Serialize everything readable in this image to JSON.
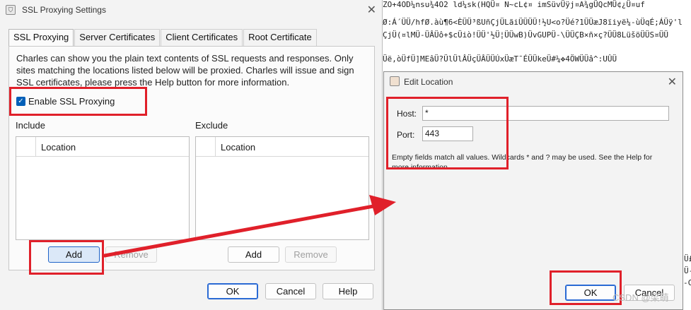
{
  "background_text": {
    "line1": "ZO+4OD¼nsu¾4O2 ld¼sk(HQÜ¤ N~cL¢¤ imSüvÜÿj¤A¾gÜQcMÜ¢¿Ü¤uf",
    "line2": "Ø:Á´ÜÜ/hfØ.àù¶6<ÈÜÜ³ßUñÇjÜLãiÜÜÜÜ!½U<o?Üé?1ÜÜæJ8ïiyë¼-ùÜqÉ;ÁÜÿ'l",
    "line3": "ÇjÜ(¤lMÜ-ÜÂÜô+$cÜiò!ÜÜ'½Ü¦ÜÜwB)ÜvGUPÜ-\\ÜÜÇB×ñ×ç?ÜÜ8LüšöÜÜS¤ÜÜ",
    "line4": "Üë,òÜfÜ]MEâÜ?ÜlÜlÂÜçÜÂÜÜÚxÜæT¯ÉÜÜkeÜ#¼✥4ÖWÜÜâ^:UÛÜ",
    "r1": "Ü£",
    "r2": "Ü-",
    "r3": "-CA"
  },
  "ssl_dialog": {
    "title": "SSL Proxying Settings",
    "close_glyph": "✕",
    "app_icon_glyph": "⛉",
    "tabs": [
      {
        "label": "SSL Proxying",
        "active": true
      },
      {
        "label": "Server Certificates",
        "active": false
      },
      {
        "label": "Client Certificates",
        "active": false
      },
      {
        "label": "Root Certificate",
        "active": false
      }
    ],
    "description_lines": [
      "Charles can show you the plain text contents of SSL requests and responses. Only",
      "sites matching the locations listed below will be proxied. Charles will issue and sign",
      "SSL certificates, please press the Help button for more information."
    ],
    "enable_checkbox": {
      "label": "Enable SSL Proxying",
      "checked": true,
      "glyph": "✓"
    },
    "include": {
      "label": "Include",
      "column": "Location",
      "add": "Add",
      "remove": "Remove"
    },
    "exclude": {
      "label": "Exclude",
      "column": "Location",
      "add": "Add",
      "remove": "Remove"
    },
    "footer": {
      "ok": "OK",
      "cancel": "Cancel",
      "help": "Help"
    }
  },
  "edit_dialog": {
    "title": "Edit Location",
    "close_glyph": "✕",
    "host_label": "Host:",
    "host_value": "*",
    "port_label": "Port:",
    "port_value": "443",
    "hint_lines": [
      "Empty fields match all values. Wildcards * and ? may be used. See the Help for",
      "more information."
    ],
    "ok": "OK",
    "cancel": "Cancel"
  },
  "watermark": "CSDN @梁萌",
  "colors": {
    "accent": "#005fb8",
    "annotation_red": "#e0202a",
    "dialog_bg": "#f3f3f3"
  }
}
